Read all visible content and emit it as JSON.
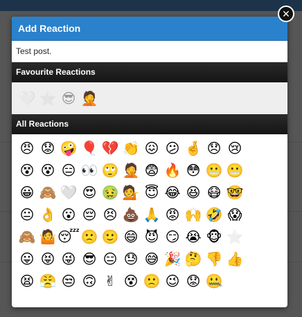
{
  "modal": {
    "title": "Add Reaction",
    "post_text": "Test post.",
    "close_glyph": "✕"
  },
  "favourites": {
    "title": "Favourite Reactions",
    "items": [
      {
        "emoji": "🤍",
        "name": "heart-icon"
      },
      {
        "emoji": "⭐",
        "name": "star-icon"
      },
      {
        "emoji": "😎",
        "name": "sunglasses-face-icon"
      },
      {
        "emoji": "🤦",
        "name": "facepalm-icon",
        "active": true
      }
    ]
  },
  "all_reactions": {
    "title": "All Reactions",
    "rows": [
      [
        "😠",
        "😟",
        "🤪",
        "🎈",
        "💔",
        "👏",
        "😖",
        "😕",
        "🤞",
        "😞",
        "😢"
      ],
      [
        "😵",
        "😵",
        "😑",
        "👀",
        "🙄",
        "🤦",
        "😨",
        "🔥",
        "😳",
        "😬",
        "😬"
      ],
      [
        "😀",
        "🙈",
        "🤍",
        "😍",
        "🤢",
        "💁",
        "😇",
        "😂",
        "😆",
        "😷",
        "🤓"
      ],
      [
        "😐",
        "👌",
        "😮",
        "😔",
        "😣",
        "💩",
        "🙏",
        "😡",
        "🙌",
        "🤣",
        "😱"
      ],
      [
        "🙈",
        "🤷",
        "😴",
        "🙁",
        "🙂",
        "😄",
        "😈",
        "😏",
        "😭",
        "🐵",
        "⭐"
      ],
      [
        "😛",
        "😝",
        "😜",
        "😎",
        "😑",
        "😓",
        "😅",
        "🎉",
        "🤔",
        "👎",
        "👍"
      ],
      [
        "😫",
        "😤",
        "😒",
        "🙃",
        "✌",
        "😵",
        "🙁",
        "😉",
        "😟",
        "🤐"
      ]
    ]
  }
}
